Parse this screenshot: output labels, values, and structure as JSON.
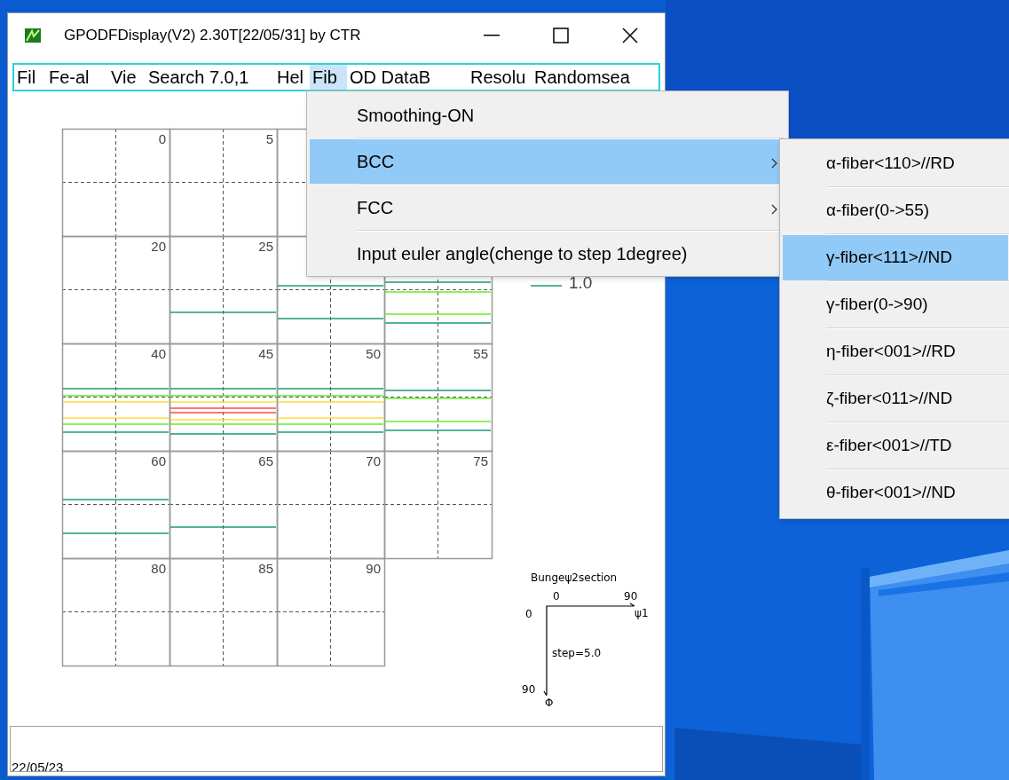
{
  "window": {
    "title": "GPODFDisplay(V2) 2.30T[22/05/31] by CTR"
  },
  "menu_bar": [
    {
      "label": "Fil",
      "selected": false
    },
    {
      "label": "Fe-al",
      "selected": false
    },
    {
      "label": "Vie",
      "selected": false
    },
    {
      "label": "Search 7.0,1",
      "selected": false
    },
    {
      "label": "Hel",
      "selected": false
    },
    {
      "label": "Fib",
      "selected": true
    },
    {
      "label": "OD DataB",
      "selected": false
    },
    {
      "label": "Resolu",
      "selected": false
    },
    {
      "label": "Randomsea",
      "selected": false
    }
  ],
  "menu": {
    "items": [
      {
        "label": "Smoothing-ON",
        "selected": false,
        "submenu": false
      },
      {
        "label": "BCC",
        "selected": true,
        "submenu": true
      },
      {
        "label": "FCC",
        "selected": false,
        "submenu": true
      },
      {
        "label": "Input euler angle(chenge to step 1degree)",
        "selected": false,
        "submenu": false
      }
    ]
  },
  "submenu": {
    "items": [
      {
        "label": "α-fiber<110>//RD",
        "selected": false
      },
      {
        "label": "α-fiber(0->55)",
        "selected": false
      },
      {
        "label": "γ-fiber<111>//ND",
        "selected": true
      },
      {
        "label": "γ-fiber(0->90)",
        "selected": false
      },
      {
        "label": "η-fiber<001>//RD",
        "selected": false
      },
      {
        "label": "ζ-fiber<011>//ND",
        "selected": false
      },
      {
        "label": "ε-fiber<001>//TD",
        "selected": false
      },
      {
        "label": "θ-fiber<001>//ND",
        "selected": false
      }
    ]
  },
  "plot": {
    "rows": [
      {
        "cells": [
          {
            "label": "0"
          },
          {
            "label": "5"
          },
          {},
          {}
        ]
      },
      {
        "cells": [
          {
            "label": "20"
          },
          {
            "label": "25"
          },
          {},
          {}
        ]
      },
      {
        "cells": [
          {
            "label": "40"
          },
          {
            "label": "45"
          },
          {
            "label": "50"
          },
          {
            "label": "55"
          }
        ]
      },
      {
        "cells": [
          {
            "label": "60"
          },
          {
            "label": "65"
          },
          {
            "label": "70"
          },
          {
            "label": "75"
          }
        ]
      },
      {
        "cells": [
          {
            "label": "80"
          },
          {
            "label": "85"
          },
          {
            "label": "90"
          }
        ]
      }
    ],
    "legend": {
      "label": "1.0"
    },
    "axis_key": {
      "title": "Bungeψ2section",
      "x_start": "0",
      "x_end": "90",
      "x_name": "ψ1",
      "y_start": "0",
      "y_end": "90",
      "y_name": "Φ",
      "step": "step=5.0"
    }
  },
  "status": {
    "text": "22/05/23"
  }
}
